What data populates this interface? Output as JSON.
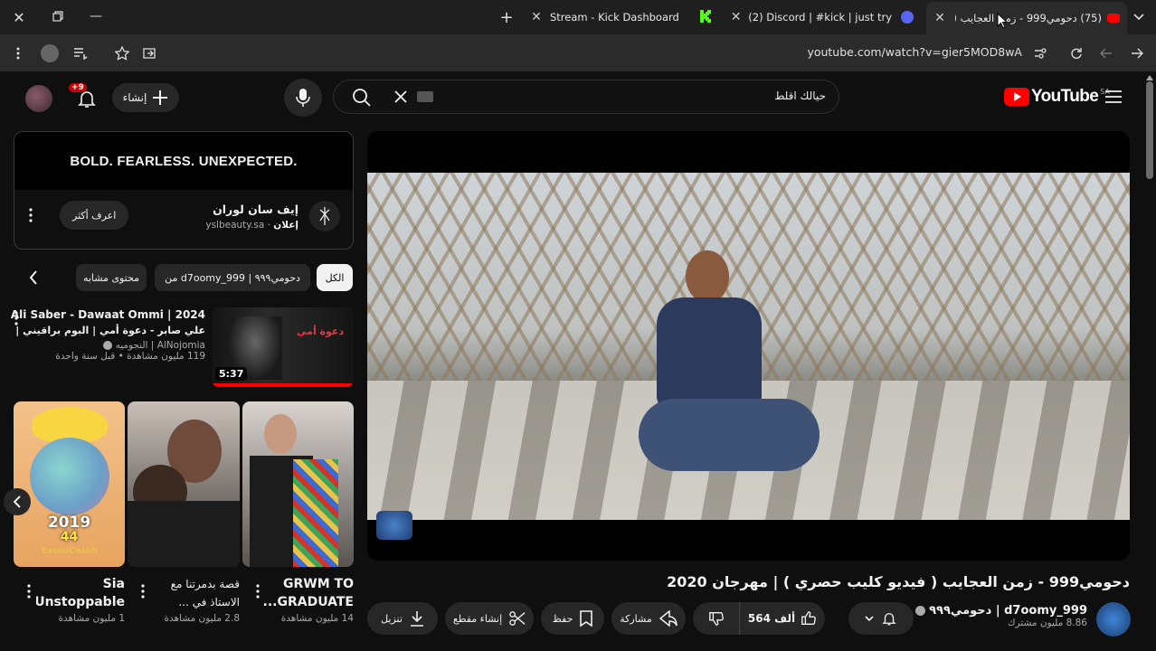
{
  "browser": {
    "tabs": [
      {
        "label": "Stream - Kick Dashboard"
      },
      {
        "label": "(2) Discord | #kick | just try"
      },
      {
        "label": "(75) دحومي999 - زمن العجايب ("
      }
    ],
    "url": "youtube.com/watch?v=gier5MOD8wA"
  },
  "youtube": {
    "logo_text": "YouTube",
    "region": "SA",
    "search_placeholder": "حيالك اقلط",
    "create_label": "إنشاء",
    "notification_badge": "+9"
  },
  "ad": {
    "banner_text": "BOLD. FEARLESS. UNEXPECTED.",
    "advertiser": "إيف سان لوران",
    "sponsored": "إعلان",
    "domain": "yslbeauty.sa",
    "cta": "اعرف أكثر"
  },
  "chips": [
    {
      "label": "الكل",
      "selected": true
    },
    {
      "label": "من d7oomy_999 | دحومي٩٩٩",
      "selected": false
    },
    {
      "label": "محتوى مشابه",
      "selected": false
    }
  ],
  "recommended": [
    {
      "title_line1": "Ali Saber - Dawaat Ommi | 2024",
      "title_line2": "علي صابر - دعوة أمي | البوم براقيني |",
      "channel": "AlNojomia | النجوميه",
      "meta": "119 مليون مشاهدة • قبل سنة واحدة",
      "duration": "5:37",
      "thumb_text": "دعوة أمي"
    }
  ],
  "shorts": [
    {
      "title_line1": "Sia",
      "title_line2": "Unstoppable...",
      "views": "1 مليون مشاهدة",
      "thumb_year": "2019",
      "thumb_num": "44",
      "thumb_brand": "EvoluCeleb"
    },
    {
      "title_line1": "قصة بدمرتنا مع",
      "title_line2": "الاستاذ في ...",
      "views": "2.8 مليون مشاهدة"
    },
    {
      "title_line1": "GRWM TO",
      "title_line2": "GRADUATE...",
      "views": "14 مليون مشاهدة"
    }
  ],
  "video": {
    "title": "دحومي999 - زمن العجايب ( فيديو كليب حصري ) | مهرجان 2020",
    "channel_name": "d7oomy_999 | دحومي٩٩٩",
    "subscribers": "8.86 مليون مشترك",
    "likes": "564 ألف",
    "share_label": "مشاركة",
    "save_label": "حفظ",
    "clip_label": "إنشاء مقطع",
    "download_label": "تنزيل"
  },
  "colors": {
    "accent": "#ff0000",
    "kick": "#53fc18",
    "chip_bg": "#272727"
  }
}
